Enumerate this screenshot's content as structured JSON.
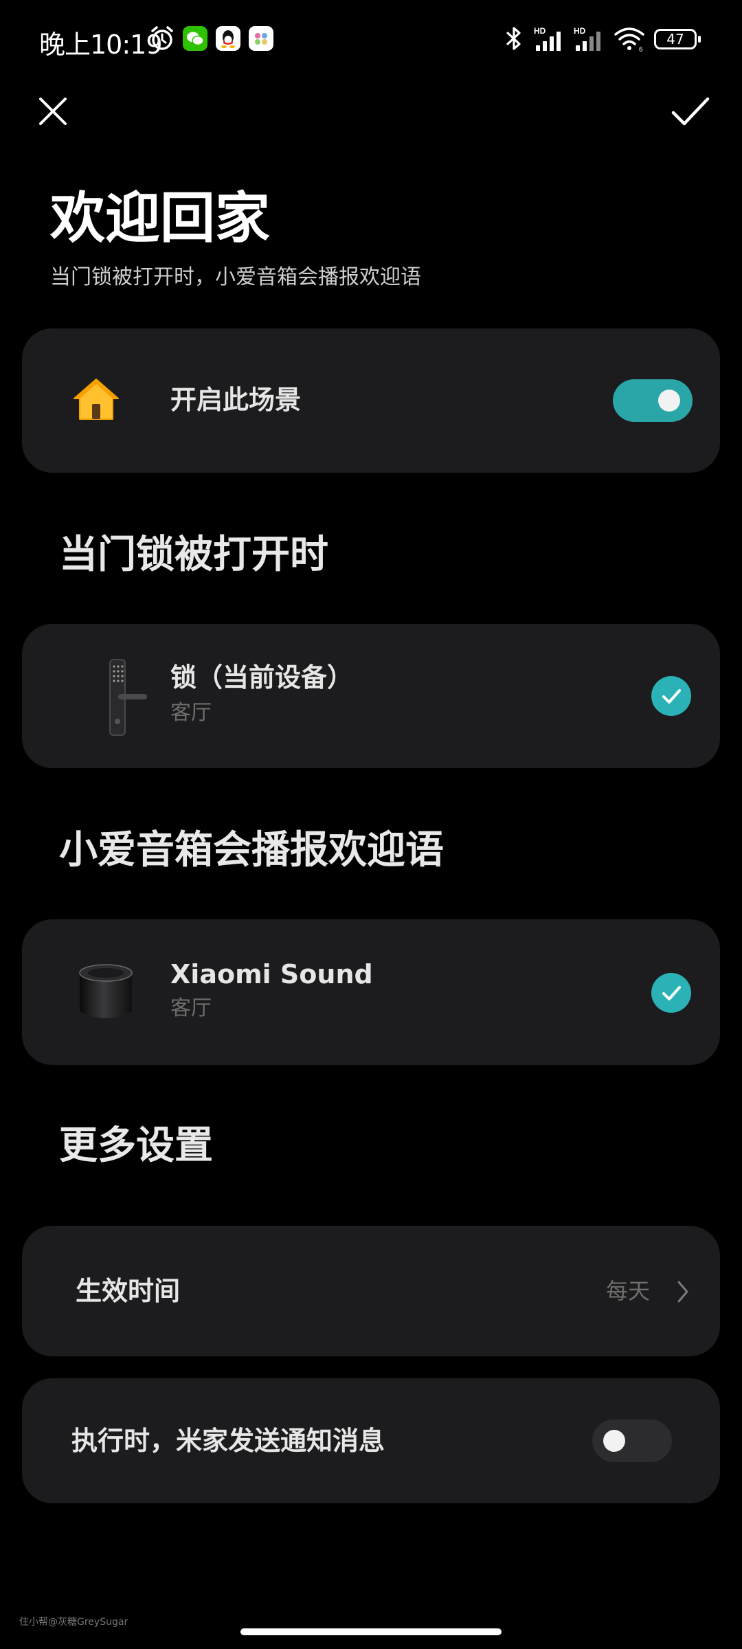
{
  "status_bar": {
    "time": "晚上10:19",
    "battery": "47",
    "icons": [
      "alarm-icon",
      "wechat-icon",
      "qq-icon",
      "app-icon",
      "bluetooth-icon",
      "signal-hd-icon",
      "signal-hd-icon",
      "wifi-icon",
      "battery-icon"
    ]
  },
  "header": {
    "close_icon": "close-icon",
    "confirm_icon": "checkmark-icon"
  },
  "title": "欢迎回家",
  "subtitle": "当门锁被打开时，小爱音箱会播报欢迎语",
  "enable_card": {
    "icon": "house-icon",
    "label": "开启此场景",
    "enabled": true
  },
  "trigger_section": {
    "heading": "当门锁被打开时",
    "device": {
      "name": "锁（当前设备）",
      "room": "客厅",
      "selected": true
    }
  },
  "action_section": {
    "heading": "小爱音箱会播报欢迎语",
    "device": {
      "name": "Xiaomi Sound",
      "room": "客厅",
      "selected": true
    }
  },
  "more_section": {
    "heading": "更多设置",
    "effective_time": {
      "label": "生效时间",
      "value": "每天"
    },
    "notify": {
      "label": "执行时，米家发送通知消息",
      "enabled": false
    }
  },
  "watermark": "住小帮@灰糖GreySugar",
  "colors": {
    "accent": "#2bb2b6",
    "card": "#1c1c1e",
    "background": "#000000",
    "house": "#ffc22e"
  }
}
